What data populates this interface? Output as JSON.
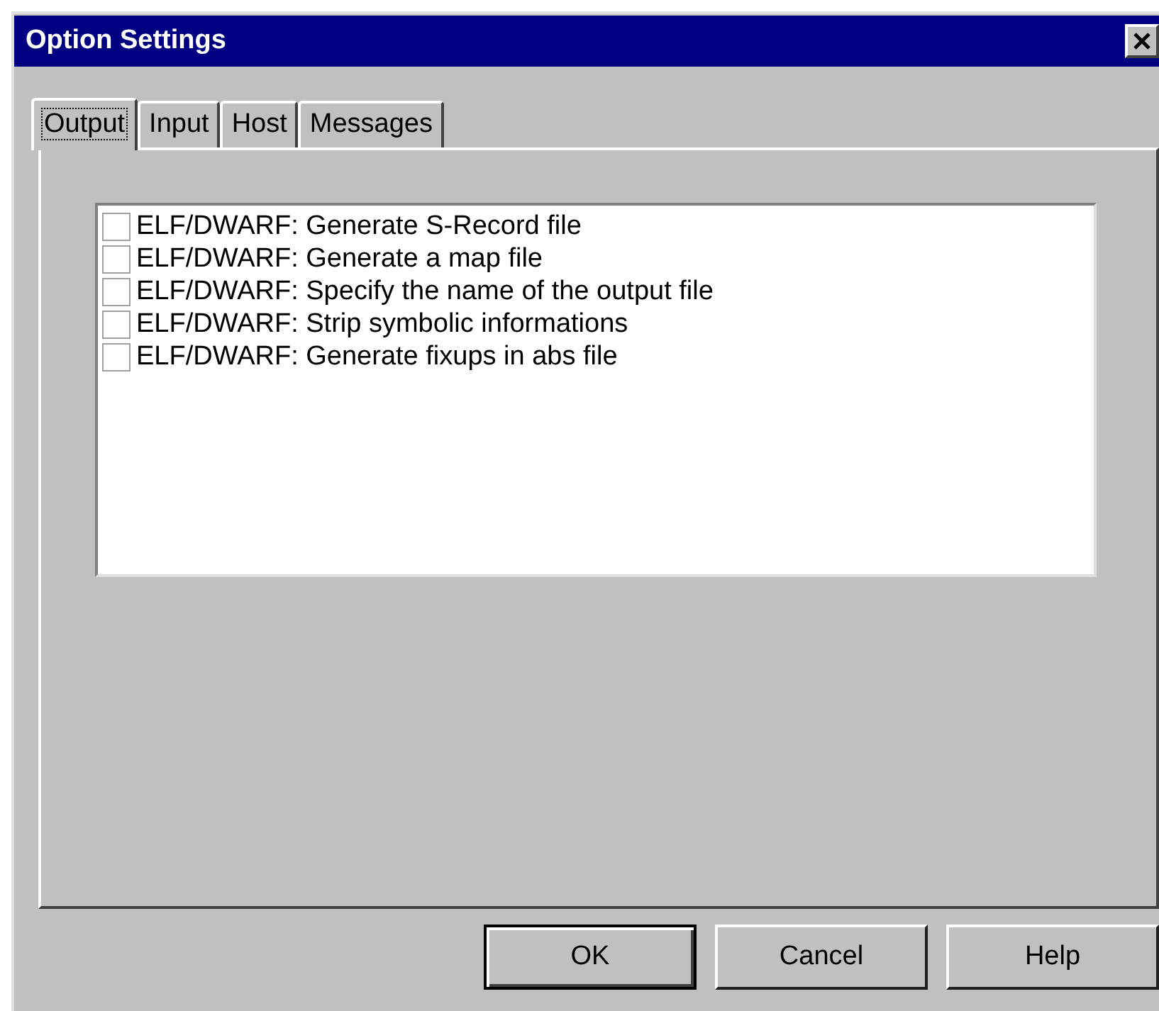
{
  "window": {
    "title": "Option Settings"
  },
  "tabs": [
    {
      "label": "Output",
      "selected": true
    },
    {
      "label": "Input",
      "selected": false
    },
    {
      "label": "Host",
      "selected": false
    },
    {
      "label": "Messages",
      "selected": false
    }
  ],
  "options": [
    {
      "label": "ELF/DWARF: Generate S-Record file",
      "checked": false
    },
    {
      "label": "ELF/DWARF: Generate a map file",
      "checked": false
    },
    {
      "label": "ELF/DWARF: Specify the name of the output file",
      "checked": false
    },
    {
      "label": "ELF/DWARF: Strip symbolic informations",
      "checked": false
    },
    {
      "label": "ELF/DWARF: Generate fixups in abs file",
      "checked": false
    }
  ],
  "buttons": [
    {
      "label": "OK",
      "default": true
    },
    {
      "label": "Cancel",
      "default": false
    },
    {
      "label": "Help",
      "default": false
    }
  ]
}
